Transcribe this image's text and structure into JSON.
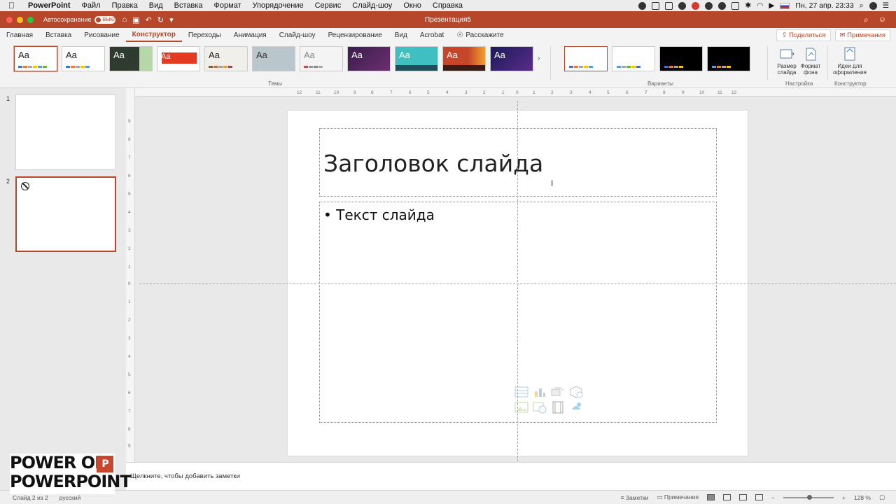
{
  "menubar": {
    "app": "PowerPoint",
    "items": [
      "Файл",
      "Правка",
      "Вид",
      "Вставка",
      "Формат",
      "Упорядочение",
      "Сервис",
      "Слайд-шоу",
      "Окно",
      "Справка"
    ],
    "clock": "Пн, 27 апр.  23:33"
  },
  "titlebar": {
    "autosave_label": "Автосохранение",
    "autosave_state": "ВЫКЛ.",
    "doc_title": "Презентация5"
  },
  "ribbon_tabs": {
    "items": [
      "Главная",
      "Вставка",
      "Рисование",
      "Конструктор",
      "Переходы",
      "Анимация",
      "Слайд-шоу",
      "Рецензирование",
      "Вид",
      "Acrobat"
    ],
    "active": "Конструктор",
    "tell_me": "Расскажите",
    "share": "Поделиться",
    "comments": "Примечания"
  },
  "ribbon": {
    "themes_group_label": "Темы",
    "theme_sample": "Aa",
    "variants_group_label": "Варианты",
    "setup_group_label": "Настройка",
    "designer_group_label": "Конструктор",
    "slide_size": "Размер слайда",
    "bg_format": "Формат фона",
    "design_ideas": "Идеи для оформления"
  },
  "thumbnails": {
    "slide1_number": "1",
    "slide2_number": "2"
  },
  "slide": {
    "title": "Заголовок слайда",
    "body": "• Текст слайда"
  },
  "notes": {
    "placeholder": "Щелкните, чтобы добавить заметки"
  },
  "status": {
    "slide_count": "Слайд 2 из 2",
    "language": "русский",
    "notes": "Заметки",
    "comments": "Примечания",
    "zoom": "128 %"
  },
  "watermark": {
    "line1": "POWER OF",
    "line2": "POWERPOINT",
    "badge": "P"
  },
  "colors": {
    "accent": "#b7472a",
    "background": "#e9e9e9"
  }
}
